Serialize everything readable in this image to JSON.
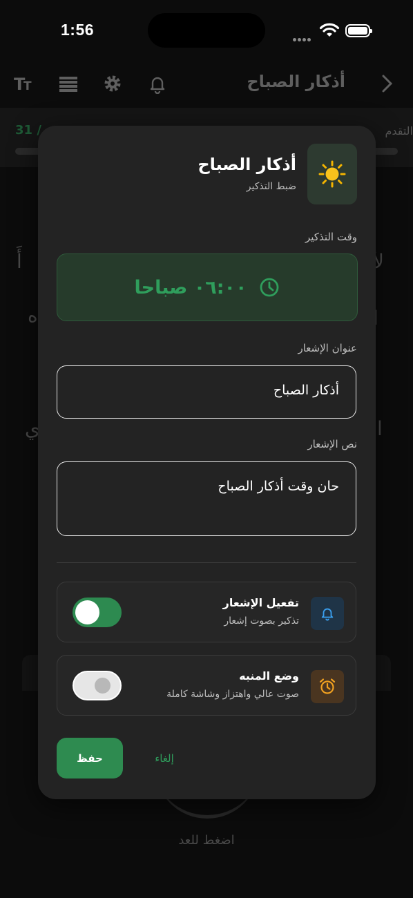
{
  "status_bar": {
    "time": "1:56"
  },
  "background": {
    "header_title": "أذكار الصباح",
    "progress_label": "التقدم",
    "progress_count": "31 / ",
    "tap_hint": "اضغط للعد",
    "icons": [
      "text-size-icon",
      "list-icon",
      "gear-icon",
      "bell-icon",
      "chevron-right-icon"
    ]
  },
  "dialog": {
    "title": "أذكار الصباح",
    "subtitle": "ضبط التذكير",
    "header_icon": "sun-icon",
    "reminder_time": {
      "label": "وقت التذكير",
      "value": "٠٦:٠٠ صباحا",
      "icon": "clock-icon"
    },
    "notification_title": {
      "label": "عنوان الإشعار",
      "value": "أذكار الصباح"
    },
    "notification_body": {
      "label": "نص الإشعار",
      "value": "حان وقت أذكار الصباح"
    },
    "options": [
      {
        "title": "تفعيل الإشعار",
        "subtitle": "تذكير بصوت إشعار",
        "icon": "bell-icon",
        "enabled": true
      },
      {
        "title": "وضع المنبه",
        "subtitle": "صوت عالي واهتزاز وشاشة كاملة",
        "icon": "alarm-clock-icon",
        "enabled": false
      }
    ],
    "save_label": "حفظ",
    "cancel_label": "إلغاء"
  },
  "colors": {
    "accent": "#2E8B50",
    "accent_text": "#2F9E5C",
    "dialog_bg": "#232323",
    "screen_bg": "#0C0C0C"
  }
}
